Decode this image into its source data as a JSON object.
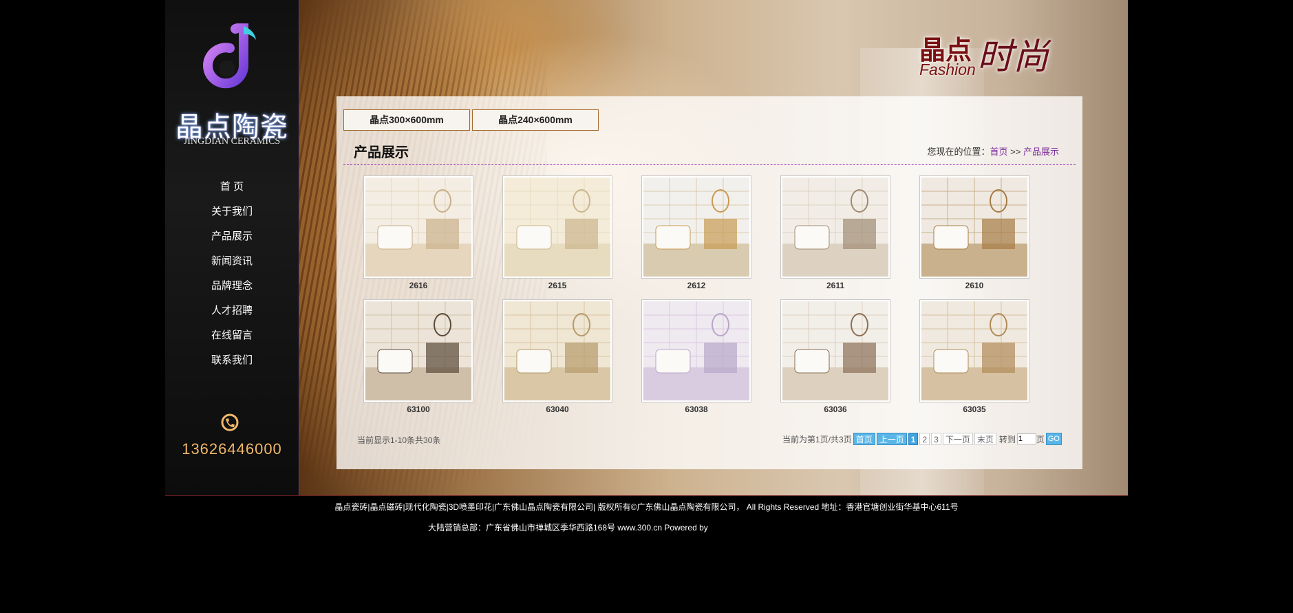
{
  "sidebar": {
    "logo_cn": "晶点陶瓷",
    "logo_en": "JINGDIAN CERAMICS",
    "nav": [
      "首 页",
      "关于我们",
      "产品展示",
      "新闻资讯",
      "品牌理念",
      "人才招聘",
      "在线留言",
      "联系我们"
    ],
    "phone": "13626446000"
  },
  "banner": {
    "brand_cn": "晶点",
    "brand_en": "Fashion",
    "brand_script": "时尚"
  },
  "tabs": [
    "晶点300×600mm",
    "晶点240×600mm"
  ],
  "page_title": "产品展示",
  "breadcrumb": {
    "prefix": "您现在的位置：",
    "home": "首页",
    "sep": " >> ",
    "current": "产品展示"
  },
  "products": [
    {
      "code": "2616",
      "scene": "bath"
    },
    {
      "code": "2615",
      "scene": "bath2"
    },
    {
      "code": "2612",
      "scene": "kitchen"
    },
    {
      "code": "2611",
      "scene": "toilet"
    },
    {
      "code": "2610",
      "scene": "kitchen2"
    },
    {
      "code": "63100",
      "scene": "bath3"
    },
    {
      "code": "63040",
      "scene": "bath4"
    },
    {
      "code": "63038",
      "scene": "bath5"
    },
    {
      "code": "63036",
      "scene": "bath6"
    },
    {
      "code": "63035",
      "scene": "kitchen3"
    }
  ],
  "list_info": "当前显示1-10条共30条",
  "pager": {
    "status": "当前为第1页/共3页",
    "first": "首页",
    "prev": "上一页",
    "pages": [
      "1",
      "2",
      "3"
    ],
    "next": "下一页",
    "last": "末页",
    "goto": "转到",
    "goto_value": "1",
    "page_unit": "页",
    "go": "GO"
  },
  "footer": {
    "line1": "晶点瓷砖|晶点磁砖|现代化陶瓷|3D喷墨印花|广东佛山晶点陶瓷有限公司|          版权所有©广东佛山晶点陶瓷有限公司， All Rights Reserved   地址：香港官塘创业街华基中心611号",
    "line2": "大陆营销总部：广东省佛山市禅城区季华西路168号        www.300.cn Powered by"
  },
  "colors": {
    "accent_purple": "#7d2a9b",
    "tab_border": "#a46a2a",
    "phone": "#f2b86a",
    "pager_blue": "#5bb6e8"
  }
}
